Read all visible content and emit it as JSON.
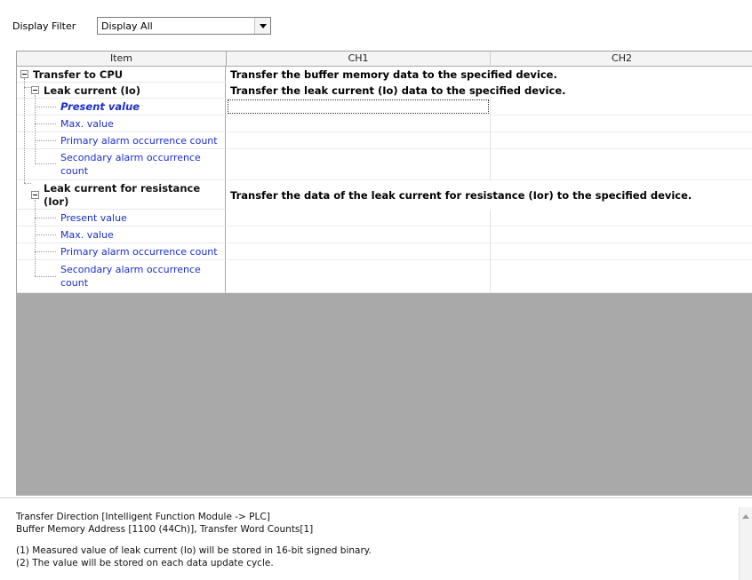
{
  "filter": {
    "label": "Display Filter",
    "value": "Display All"
  },
  "columns": {
    "item": "Item",
    "ch1": "CH1",
    "ch2": "CH2"
  },
  "rows": {
    "transfer_to_cpu": {
      "label": "Transfer to CPU",
      "span": "Transfer the buffer memory data to the specified device."
    },
    "leak_io": {
      "label": "Leak current (Io)",
      "span": "Transfer the leak current (Io) data to the specified device."
    },
    "io_present": {
      "label": "Present value"
    },
    "io_max": {
      "label": "Max. value"
    },
    "io_primary": {
      "label": "Primary alarm occurrence count"
    },
    "io_secondary_1": {
      "label": "Secondary alarm occurrence"
    },
    "io_secondary_2": {
      "label": "count"
    },
    "leak_ior_1": {
      "label": "Leak current for resistance"
    },
    "leak_ior_2": {
      "label": "(Ior)"
    },
    "leak_ior_span": "Transfer the data of the leak current for resistance (Ior) to the specified device.",
    "ior_present": {
      "label": "Present value"
    },
    "ior_max": {
      "label": "Max. value"
    },
    "ior_primary": {
      "label": "Primary alarm occurrence count"
    },
    "ior_secondary_1": {
      "label": "Secondary alarm occurrence"
    },
    "ior_secondary_2": {
      "label": "count"
    }
  },
  "description": {
    "line1": "Transfer Direction [Intelligent Function Module -> PLC]",
    "line2": "Buffer Memory Address [1100 (44Ch)], Transfer Word Counts[1]",
    "line3": "(1) Measured value of leak current (Io) will be stored in 16-bit signed binary.",
    "line4": "(2) The value will be stored on each data update cycle."
  }
}
